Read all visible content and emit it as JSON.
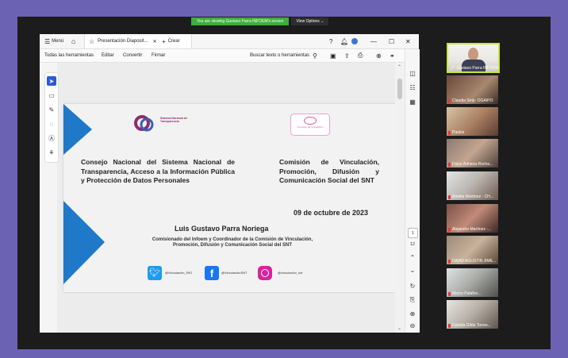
{
  "share_banner": {
    "text": "You are viewing Gustavo Parra INFOEM's screen",
    "view_options": "View Options"
  },
  "app": {
    "menu_label": "Menú",
    "tab_title": "Presentación Diaposit...",
    "new_tab": "Crear",
    "menu_items": [
      "Todas las herramientas",
      "Editar",
      "Convertir",
      "Firmar"
    ],
    "search_label": "Buscar texto o herramientas",
    "page_number": "1",
    "page_total": "12"
  },
  "slide": {
    "logo_text": "Sistema Nacional de Transparencia",
    "badge_text": "Comisión de Vinculación",
    "left_title": "Consejo Nacional del Sistema Nacional de Transparencia, Acceso a la Información Pública y Protección de Datos Personales",
    "right_title": "Comisión de Vinculación, Promoción, Difusión y Comunicación Social del SNT",
    "date": "09 de octubre de 2023",
    "speaker": "Luis Gustavo Parra Noriega",
    "speaker_role": "Comisionado del Infoem y Coordinador de la Comisión de Vinculación, Promoción, Difusión y Comunicación Social del SNT",
    "social": [
      {
        "network": "twitter",
        "handle": "@Vinculación_SNT",
        "color": "#1d9bf0"
      },
      {
        "network": "facebook",
        "handle": "@VinculaciónSNT",
        "color": "#1877f2"
      },
      {
        "network": "instagram",
        "handle": "@vinculación_snt",
        "color": "#d6249f"
      }
    ]
  },
  "participants": [
    {
      "name": "Gustavo Parra INFOEM",
      "active": true
    },
    {
      "name": "Claudia Sotp- OGAIPO"
    },
    {
      "name": "Paulos"
    },
    {
      "name": "Dulce Adriana Rocha..."
    },
    {
      "name": "Amelia Martínez - CH..."
    },
    {
      "name": "Alejandro Martínez -..."
    },
    {
      "name": "DAVID AGUSTIN JIME..."
    },
    {
      "name": "Marco Palafox..."
    },
    {
      "name": "Fabiola Gilda Torres..."
    }
  ],
  "colors": {
    "accent": "#2a5bd7",
    "active_speaker": "#c8e63b",
    "slide_blue": "#1f78c8"
  }
}
